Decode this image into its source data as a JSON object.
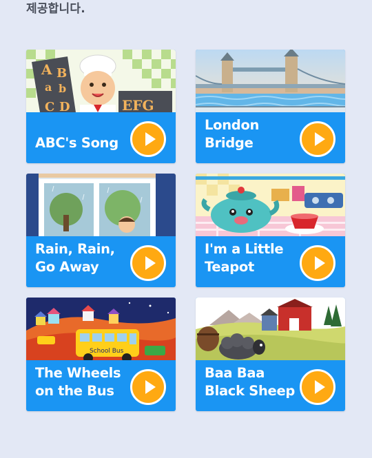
{
  "intro_text": "제공합니다.",
  "cards": [
    {
      "title": "ABC's Song",
      "thumb_icon": "abc-song-thumbnail"
    },
    {
      "title": "London\nBridge",
      "thumb_icon": "london-bridge-thumbnail"
    },
    {
      "title": "Rain, Rain,\nGo Away",
      "thumb_icon": "rain-window-thumbnail"
    },
    {
      "title": "I'm a Little\nTeapot",
      "thumb_icon": "teapot-thumbnail"
    },
    {
      "title": "The Wheels\non the Bus",
      "thumb_icon": "school-bus-thumbnail"
    },
    {
      "title": "Baa Baa\nBlack Sheep",
      "thumb_icon": "black-sheep-thumbnail"
    }
  ],
  "thumb_texts": {
    "abc": "ABabCDEFG",
    "bus": "School Bus"
  },
  "colors": {
    "background": "#e3e8f5",
    "card": "#1a95f3",
    "play": "#ffa912"
  }
}
